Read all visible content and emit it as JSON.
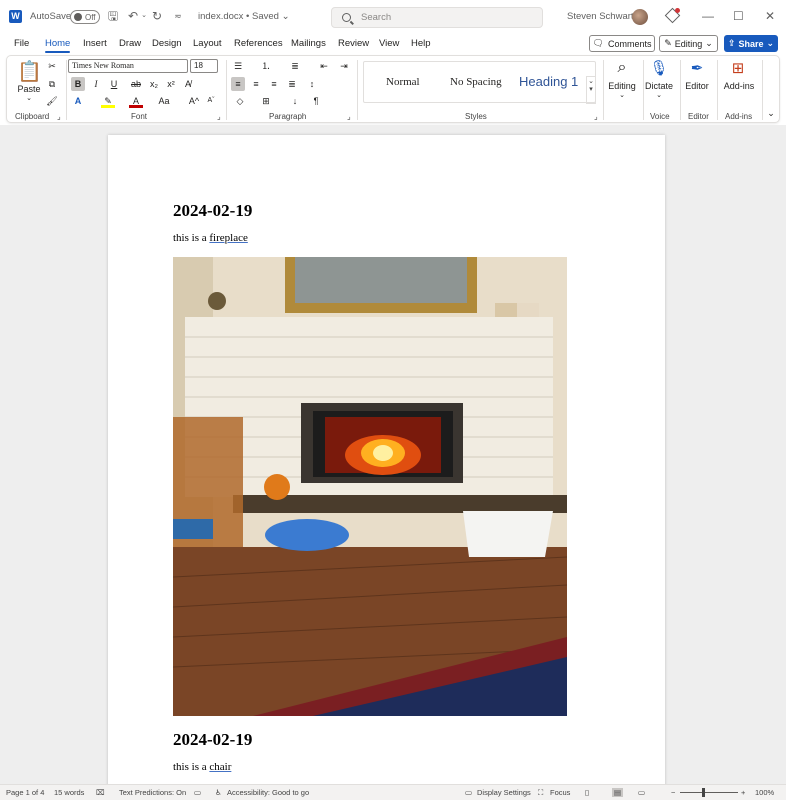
{
  "titlebar": {
    "autosave_label": "AutoSave",
    "toggle_state": "Off",
    "doc_name": "index.docx • Saved ⌄",
    "search_placeholder": "Search",
    "user_name": "Steven Schwartz",
    "window_controls": [
      "—",
      "☐",
      "✕"
    ]
  },
  "menu": {
    "tabs": [
      "File",
      "Home",
      "Insert",
      "Draw",
      "Design",
      "Layout",
      "References",
      "Mailings",
      "Review",
      "View",
      "Help"
    ],
    "active_tab": "Home",
    "comments_label": "Comments",
    "editing_label": "Editing",
    "share_label": "Share"
  },
  "ribbon": {
    "clipboard": {
      "paste_label": "Paste",
      "group_label": "Clipboard"
    },
    "font": {
      "font_name": "Times New Roman",
      "font_size": "18",
      "group_label": "Font"
    },
    "paragraph": {
      "group_label": "Paragraph"
    },
    "styles": {
      "items": [
        "Normal",
        "No Spacing",
        "Heading 1"
      ],
      "group_label": "Styles"
    },
    "editing": {
      "label": "Editing"
    },
    "voice": {
      "dictate_label": "Dictate",
      "group_label": "Voice"
    },
    "editor": {
      "label": "Editor",
      "group_label": "Editor"
    },
    "addins": {
      "label": "Add-ins",
      "group_label": "Add-ins"
    }
  },
  "document": {
    "entries": [
      {
        "heading": "2024-02-19",
        "prefix": "this is a ",
        "link": "fireplace"
      },
      {
        "heading": "2024-02-19",
        "prefix": "this is a ",
        "link": "chair"
      }
    ]
  },
  "statusbar": {
    "page": "Page 1 of 4",
    "words": "15 words",
    "text_predictions": "Text Predictions: On",
    "accessibility": "Accessibility: Good to go",
    "display_settings": "Display Settings",
    "focus": "Focus",
    "zoom": "100%"
  }
}
